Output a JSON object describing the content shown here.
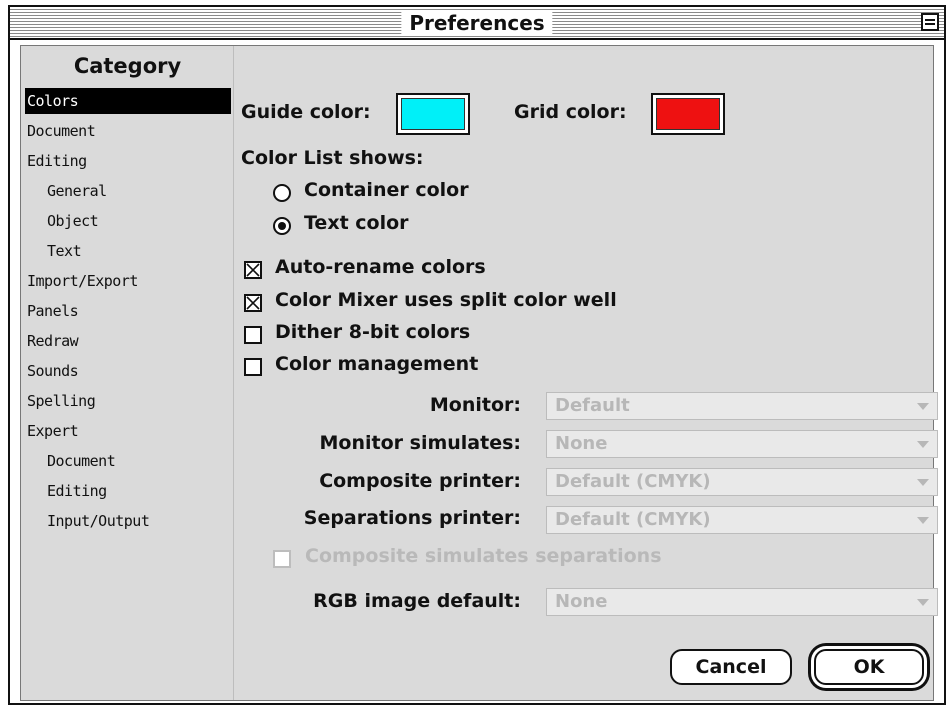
{
  "window": {
    "title": "Preferences"
  },
  "sidebar": {
    "title": "Category",
    "items": [
      {
        "label": "Colors",
        "indent": false,
        "selected": true
      },
      {
        "label": "Document",
        "indent": false
      },
      {
        "label": "Editing",
        "indent": false
      },
      {
        "label": "General",
        "indent": true
      },
      {
        "label": "Object",
        "indent": true
      },
      {
        "label": "Text",
        "indent": true
      },
      {
        "label": "Import/Export",
        "indent": false
      },
      {
        "label": "Panels",
        "indent": false
      },
      {
        "label": "Redraw",
        "indent": false
      },
      {
        "label": "Sounds",
        "indent": false
      },
      {
        "label": "Spelling",
        "indent": false
      },
      {
        "label": "Expert",
        "indent": false
      },
      {
        "label": "Document",
        "indent": true
      },
      {
        "label": "Editing",
        "indent": true
      },
      {
        "label": "Input/Output",
        "indent": true
      }
    ]
  },
  "colors": {
    "guide_label": "Guide color:",
    "guide_color": "#00f0f8",
    "grid_label": "Grid color:",
    "grid_color": "#ee1111",
    "list_shows_label": "Color List shows:",
    "radio_container": "Container color",
    "radio_text": "Text color",
    "selected_radio": "Text color",
    "auto_rename": "Auto-rename colors",
    "split_well": "Color Mixer uses split color well",
    "dither": "Dither 8-bit colors",
    "color_management": "Color management"
  },
  "management": {
    "monitor_label": "Monitor:",
    "monitor_value": "Default",
    "simulates_label": "Monitor simulates:",
    "simulates_value": "None",
    "composite_label": "Composite printer:",
    "composite_value": "Default (CMYK)",
    "separations_label": "Separations printer:",
    "separations_value": "Default (CMYK)",
    "composite_sim_label": "Composite simulates separations",
    "rgb_label": "RGB image default:",
    "rgb_value": "None"
  },
  "buttons": {
    "cancel": "Cancel",
    "ok": "OK"
  }
}
